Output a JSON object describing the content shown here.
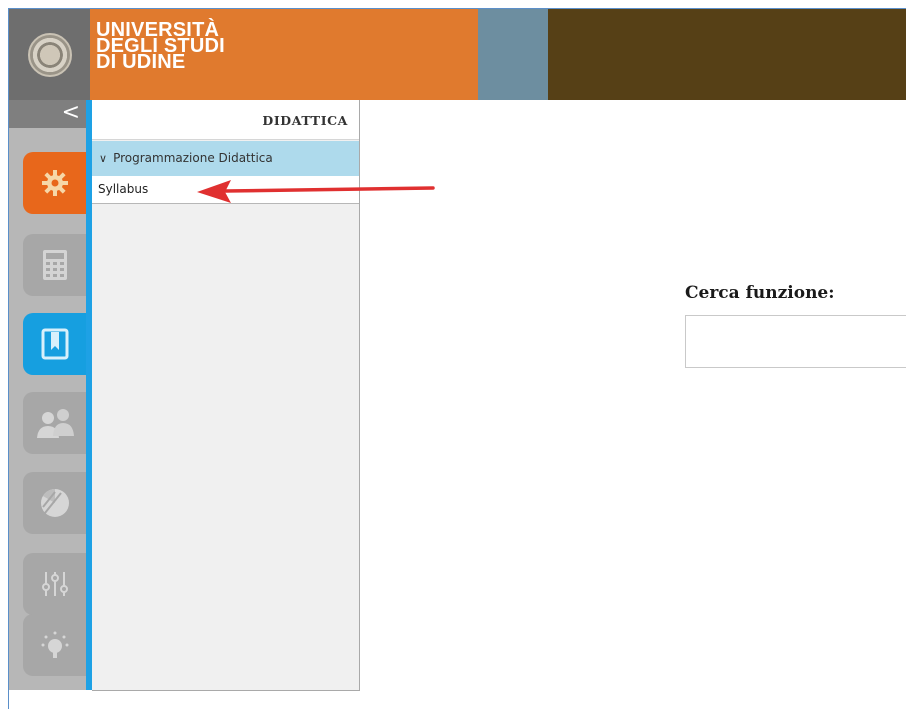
{
  "header": {
    "brand_lines": [
      "UNIVERSITÀ",
      "DEGLI STUDI",
      "DI UDINE"
    ],
    "colors": {
      "bar": "#564016",
      "brand": "#e07a2e",
      "steel": "#6d8ea0",
      "seal_bg": "#6e6e6e"
    }
  },
  "rail": {
    "collapse_glyph": "<",
    "tiles": [
      {
        "icon": "gear-icon",
        "active": true,
        "color": "#e8671b"
      },
      {
        "icon": "calculator-icon",
        "active": false
      },
      {
        "icon": "book-icon",
        "active": true,
        "color": "#169fe0"
      },
      {
        "icon": "users-icon",
        "active": false
      },
      {
        "icon": "pie-chart-icon",
        "active": false
      },
      {
        "icon": "sliders-icon",
        "active": false
      },
      {
        "icon": "lamp-icon",
        "active": false
      }
    ]
  },
  "sidebar": {
    "title": "DIDATTICA",
    "group": {
      "label": "Programmazione Didattica",
      "expanded": true,
      "chevron": "∨"
    },
    "items": [
      {
        "label": "Syllabus"
      }
    ]
  },
  "annotation": {
    "arrow_color": "#e03030"
  },
  "search": {
    "label": "Cerca funzione:",
    "value": "",
    "placeholder": ""
  }
}
